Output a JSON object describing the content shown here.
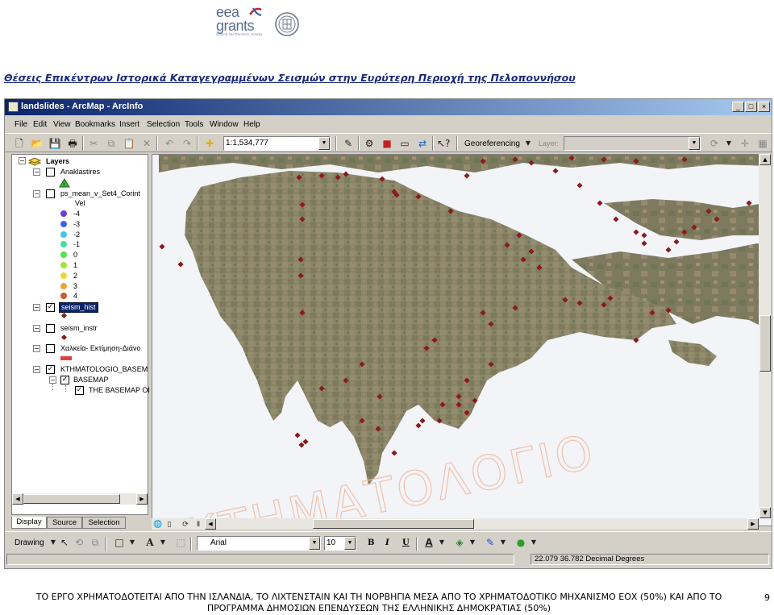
{
  "header": {
    "logo_line1": "eea",
    "logo_line2": "grants",
    "logo_tagline": "iceland liechtenstein norway",
    "title": "Θέσεις Επικέντρων Ιστορικά Καταγεγραμμένων Σεισμών στην Ευρύτερη Περιοχή της Πελοποννήσου"
  },
  "window": {
    "title": "landslides - ArcMap - ArcInfo",
    "controls": [
      "_",
      "□",
      "×"
    ]
  },
  "menu": [
    "File",
    "Edit",
    "View",
    "Bookmarks",
    "Insert",
    "Selection",
    "Tools",
    "Window",
    "Help"
  ],
  "toolbar": {
    "scale": "1:1,534,777",
    "georeferencing_label": "Georeferencing",
    "layer_label": "Layer:",
    "layer_value": ""
  },
  "toc": {
    "root": "Layers",
    "layers": [
      {
        "name": "Anaklastires",
        "checked": false
      },
      {
        "name": "ps_mean_v_Set4_Corint",
        "checked": false,
        "field": "Vel",
        "classes": [
          {
            "label": "-4",
            "color": "#6a3fd0"
          },
          {
            "label": "-3",
            "color": "#3f63e6"
          },
          {
            "label": "-2",
            "color": "#3cc6e8"
          },
          {
            "label": "-1",
            "color": "#3fe0a0"
          },
          {
            "label": "0",
            "color": "#4ce44c"
          },
          {
            "label": "1",
            "color": "#a6e23a"
          },
          {
            "label": "2",
            "color": "#e6d93a"
          },
          {
            "label": "3",
            "color": "#e8a33a"
          },
          {
            "label": "4",
            "color": "#c95a2a"
          }
        ]
      },
      {
        "name": "seism_hist",
        "checked": true,
        "selected": true
      },
      {
        "name": "seism_instr",
        "checked": false
      },
      {
        "name": "Χαλκεία- Εκτίμηση-Διάνο",
        "checked": false
      },
      {
        "name": "KTHMATOLOGIO_BASEM",
        "checked": true
      },
      {
        "name": "BASEMAP",
        "checked": true
      },
      {
        "name": "THE BASEMAP OI",
        "checked": true
      }
    ],
    "tabs": [
      "Display",
      "Source",
      "Selection"
    ]
  },
  "map": {
    "watermark": "ΚΤΗΜΑΤΟΛΟΓΙΟ",
    "point_color": "#8b1a1a"
  },
  "drawing_toolbar": {
    "drawing_label": "Drawing",
    "font_name": "Arial",
    "font_size": "10",
    "bold": "B",
    "italic": "I",
    "underline": "U"
  },
  "status": {
    "coords": "22.079  36.782 Decimal Degrees"
  },
  "footer": {
    "text_line1": "ΤΟ ΕΡΓΟ ΧΡΗΜΑΤΟΔΟΤΕΙΤΑΙ ΑΠΟ ΤΗΝ ΙΣΛΑΝΔΙΑ, ΤΟ ΛΙΧΤΕΝΣΤΑΙΝ ΚΑΙ ΤΗ ΝΟΡΒΗΓΙΑ ΜΕΣΑ ΑΠΟ ΤΟ ΧΡΗΜΑΤΟΔΟΤΙΚΟ ΜΗΧΑΝΙΣΜΟ ΕΟΧ (50%) ΚΑΙ ΑΠΟ ΤΟ",
    "text_line2": "ΠΡΟΓΡΑΜΜΑ ΔΗΜΟΣΙΩΝ ΕΠΕΝΔΥΣΕΩΝ ΤΗΣ ΕΛΛΗΝΙΚΗΣ ΔΗΜΟΚΡΑΤΙΑΣ (50%)",
    "page_number": "9"
  }
}
